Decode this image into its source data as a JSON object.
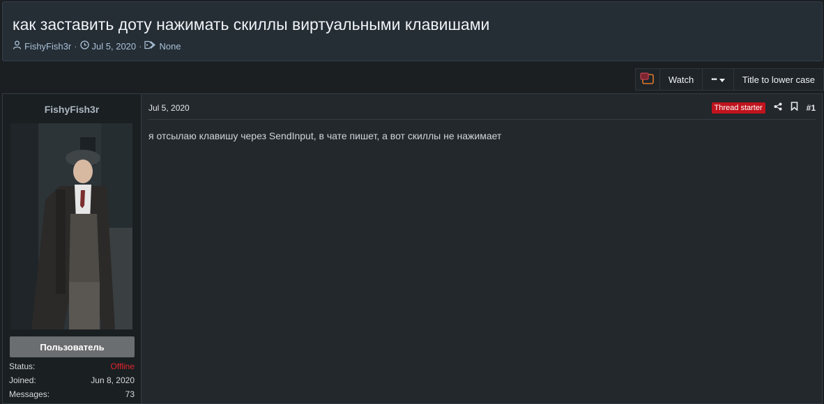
{
  "thread": {
    "title": "как заставить доту нажимать скиллы виртуальными клавишами",
    "author": "FishyFish3r",
    "date": "Jul 5, 2020",
    "tags": "None",
    "separator": "·"
  },
  "toolbar": {
    "watch_label": "Watch",
    "more_label": "•••",
    "title_lower_label": "Title to lower case"
  },
  "user": {
    "name": "FishyFish3r",
    "role": "Пользователь",
    "stats": [
      {
        "label": "Status:",
        "value": "Offline"
      },
      {
        "label": "Joined:",
        "value": "Jun 8, 2020"
      },
      {
        "label": "Messages:",
        "value": "73"
      }
    ]
  },
  "post": {
    "date": "Jul 5, 2020",
    "badge": "Thread starter",
    "number": "#1",
    "body": "я отсылаю клавишу через SendInput, в чате пишет, а вот скиллы не нажимает"
  },
  "icons": [
    "user-icon",
    "clock-icon",
    "tag-icon",
    "share-icon",
    "bookmark-icon",
    "chevron-down-icon"
  ],
  "colors": {
    "badge": "#c0131d",
    "offline": "#e0262c"
  }
}
